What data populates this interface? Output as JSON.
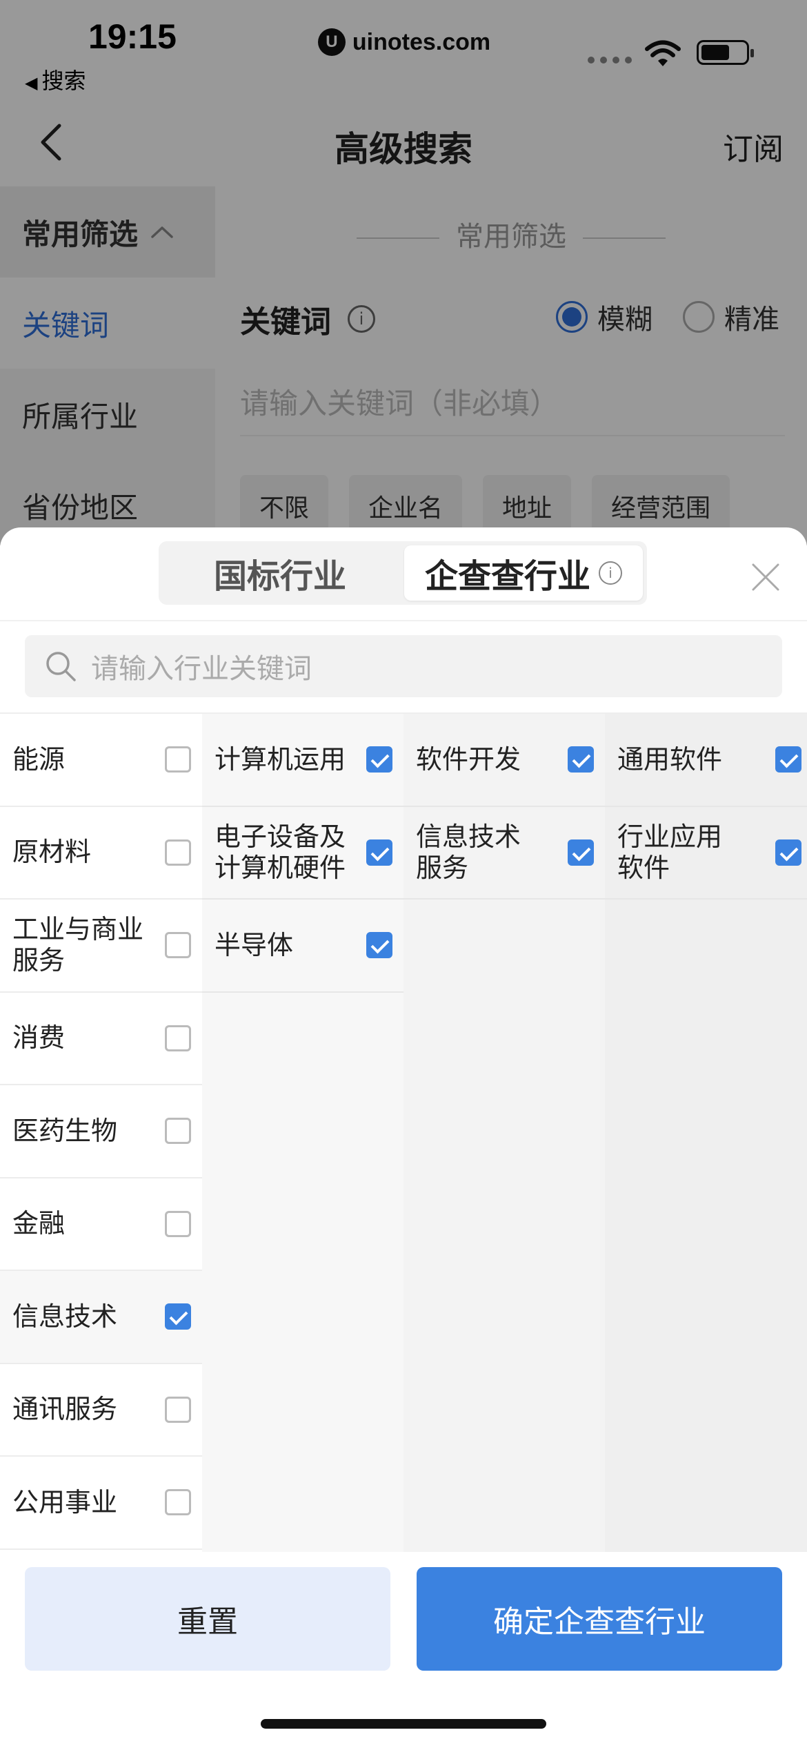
{
  "status": {
    "time": "19:15",
    "back_label": "搜索",
    "url": "uinotes.com",
    "logo": "U"
  },
  "nav": {
    "title": "高级搜索",
    "subscribe": "订阅"
  },
  "left_nav": {
    "section": "常用筛选",
    "items": [
      "关键词",
      "所属行业",
      "省份地区"
    ]
  },
  "right": {
    "section_title": "常用筛选",
    "keyword_label": "关键词",
    "radio": [
      "模糊",
      "精准"
    ],
    "radio_selected": 0,
    "keyword_placeholder": "请输入关键词（非必填）",
    "chips": [
      "不限",
      "企业名",
      "地址",
      "经营范围"
    ]
  },
  "sheet": {
    "tabs": [
      "国标行业",
      "企查查行业"
    ],
    "active_tab": 1,
    "search_placeholder": "请输入行业关键词",
    "categories": [
      {
        "label": "能源",
        "checked": false
      },
      {
        "label": "原材料",
        "checked": false
      },
      {
        "label": "工业与商业服务",
        "checked": false
      },
      {
        "label": "消费",
        "checked": false
      },
      {
        "label": "医药生物",
        "checked": false
      },
      {
        "label": "金融",
        "checked": false
      },
      {
        "label": "信息技术",
        "checked": true
      },
      {
        "label": "通讯服务",
        "checked": false
      },
      {
        "label": "公用事业",
        "checked": false
      }
    ],
    "level2": [
      {
        "label": "计算机运用",
        "checked": true
      },
      {
        "label": "电子设备及计算机硬件",
        "checked": true
      },
      {
        "label": "半导体",
        "checked": true
      }
    ],
    "level3": [
      {
        "label": "软件开发",
        "checked": true
      },
      {
        "label": "信息技术服务",
        "checked": true
      }
    ],
    "level4": [
      {
        "label": "通用软件",
        "checked": true
      },
      {
        "label": "行业应用软件",
        "checked": true
      }
    ],
    "reset_label": "重置",
    "confirm_label": "确定企查查行业"
  },
  "colors": {
    "accent": "#3b82e0",
    "reset_bg": "#e6edfb"
  }
}
